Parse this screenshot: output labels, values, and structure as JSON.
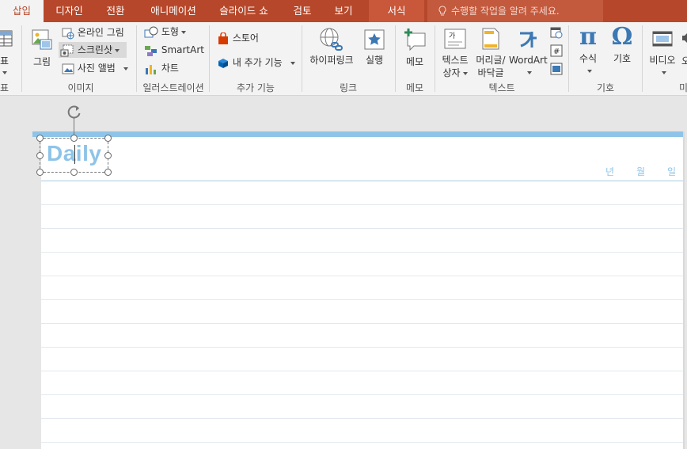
{
  "tabs": [
    {
      "label": "삽입",
      "active": true
    },
    {
      "label": "디자인"
    },
    {
      "label": "전환"
    },
    {
      "label": "애니메이션"
    },
    {
      "label": "슬라이드 쇼"
    },
    {
      "label": "검토"
    },
    {
      "label": "보기"
    },
    {
      "label": "서식",
      "contextual": true
    }
  ],
  "tell_me": "수행할 작업을 알려 주세요.",
  "ribbon": {
    "table_group_label_partial": "표",
    "images": {
      "group_label": "이미지",
      "picture": "그림",
      "online_picture": "온라인 그림",
      "screenshot": "스크린샷",
      "photo_album": "사진 앨범"
    },
    "illustrations": {
      "group_label": "일러스트레이션",
      "shapes": "도형",
      "smartart": "SmartArt",
      "chart": "차트"
    },
    "addins": {
      "group_label": "추가 기능",
      "store": "스토어",
      "my_addins": "내 추가 기능"
    },
    "links": {
      "group_label": "링크",
      "hyperlink": "하이퍼링크",
      "action": "실행"
    },
    "comments": {
      "group_label": "메모",
      "comment": "메모"
    },
    "text": {
      "group_label": "텍스트",
      "textbox_line1": "텍스트",
      "textbox_line2": "상자",
      "header_line1": "머리글/",
      "header_line2": "바닥글",
      "wordart": "WordArt"
    },
    "symbols": {
      "group_label": "기호",
      "equation": "수식",
      "symbol": "기호"
    },
    "media": {
      "group_label_partial": "미",
      "video": "비디오",
      "audio_partial": "오"
    }
  },
  "slide": {
    "title": "Daily",
    "date_year": "년",
    "date_month": "월",
    "date_day": "일"
  },
  "colors": {
    "accent": "#b7472a",
    "slide_accent": "#8ec4e8"
  }
}
